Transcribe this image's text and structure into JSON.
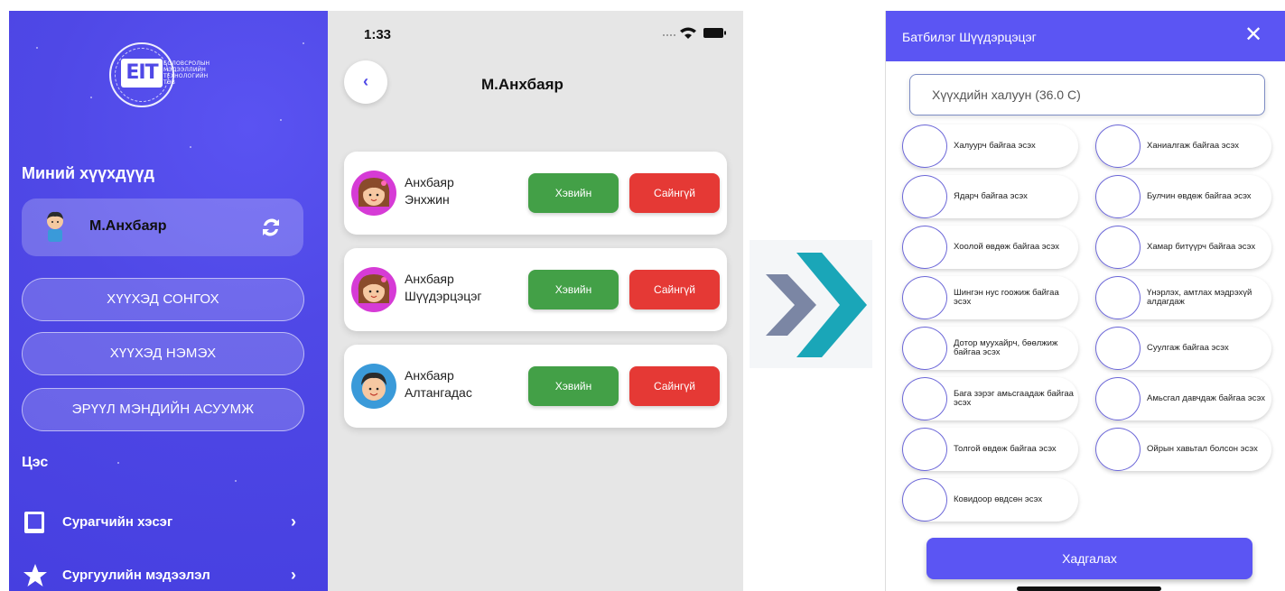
{
  "sidebar": {
    "logo": {
      "mark": "EIT",
      "caption": [
        "БОЛОВСРОЛЫН",
        "МЭДЭЭЛЛИЙН",
        "ТЕХНОЛОГИЙН",
        "ТӨВ"
      ]
    },
    "my_kids_heading": "Миний хүүхдүүд",
    "current_child": "М.Анхбаяр",
    "buttons": {
      "select_child": "ХҮҮХЭД СОНГОХ",
      "add_child": "ХҮҮХЭД НЭМЭХ",
      "health_survey": "ЭРҮҮЛ МЭНДИЙН АСУУМЖ"
    },
    "menu_heading": "Цэс",
    "menu_items": [
      {
        "label": "Сурагчийн хэсэг",
        "icon": "book-icon"
      },
      {
        "label": "Сургуулийн мэдээлэл",
        "icon": "star-icon"
      }
    ]
  },
  "phone": {
    "time": "1:33",
    "title": "М.Анхбаяр",
    "kids": [
      {
        "name_line1": "Анхбаяр",
        "name_line2": "Энхжин",
        "ok_label": "Хэвийн",
        "bad_label": "Сайнгүй",
        "avatar": "girl-avatar"
      },
      {
        "name_line1": "Анхбаяр",
        "name_line2": "Шүүдэрцэцэг",
        "ok_label": "Хэвийн",
        "bad_label": "Сайнгүй",
        "avatar": "girl-avatar"
      },
      {
        "name_line1": "Анхбаяр",
        "name_line2": "Алтангадас",
        "ok_label": "Хэвийн",
        "bad_label": "Сайнгүй",
        "avatar": "boy-avatar"
      }
    ]
  },
  "dialog": {
    "title": "Батбилэг Шүүдэрцэцэг",
    "temperature_placeholder": "Хүүхдийн халуун (36.0 С)",
    "symptoms": [
      "Халуурч байгаа эсэх",
      "Ханиалгаж байгаа эсэх",
      "Ядарч байгаа эсэх",
      "Булчин өвдөж байгаа эсэх",
      "Хоолой өвдөж байгаа эсэх",
      "Хамар битүүрч байгаа эсэх",
      "Шингэн нус гоожиж байгаа эсэх",
      "Үнэрлэх, амтлах мэдрэхүй алдагдаж",
      "Дотор муухайрч, бөөлжиж байгаа эсэх",
      "Суулгаж байгаа эсэх",
      "Бага зэрэг амьсгаадаж байгаа эсэх",
      "Амьсгал давчдаж байгаа эсэх",
      "Толгой өвдөж байгаа эсэх",
      "Ойрын хавьтал болсон эсэх",
      "Ковидоор өвдсөн эсэх"
    ],
    "save_label": "Хадгалах"
  },
  "colors": {
    "sidebar_bg": "#4f48e6",
    "accent": "#5b55f3",
    "ok_green": "#43a047",
    "bad_red": "#e53935"
  }
}
